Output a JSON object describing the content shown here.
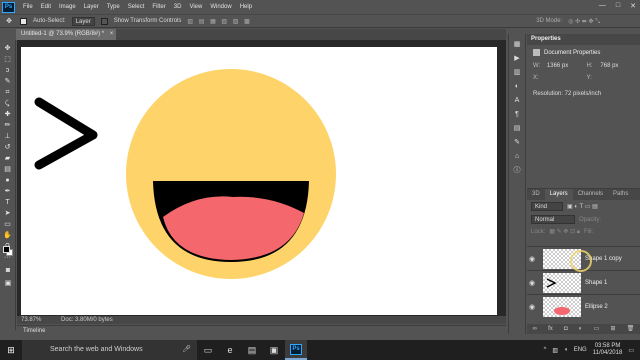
{
  "app": {
    "logo": "Ps"
  },
  "menu": [
    "File",
    "Edit",
    "Image",
    "Layer",
    "Type",
    "Select",
    "Filter",
    "3D",
    "View",
    "Window",
    "Help"
  ],
  "window_controls": [
    "—",
    "□",
    "✕"
  ],
  "options": {
    "auto_select_label": "Auto-Select:",
    "auto_select_value": "Layer",
    "transform_label": "Show Transform Controls",
    "mode_3d": "3D Mode:"
  },
  "document": {
    "tab_title": "Untitled-1 @ 73.9% (RGB/8#) *",
    "zoom": "73.87%",
    "doc_info": "Doc: 3.80M/0 bytes"
  },
  "timeline_label": "Timeline",
  "properties": {
    "tab": "Properties",
    "title": "Document Properties",
    "w_label": "W:",
    "w_value": "1366 px",
    "h_label": "H:",
    "h_value": "768 px",
    "x_label": "X:",
    "y_label": "Y:",
    "resolution": "Resolution: 72 pixels/inch"
  },
  "layers_panel": {
    "tabs": [
      "3D",
      "Layers",
      "Channels",
      "Paths"
    ],
    "active_tab": "Layers",
    "filter": "Kind",
    "blend": "Normal",
    "opacity_label": "Opacity:",
    "lock_label": "Lock:",
    "fill_label": "Fill:",
    "layers": [
      {
        "name": "Shape 1 copy"
      },
      {
        "name": "Shape 1"
      },
      {
        "name": "Ellipse 2"
      }
    ]
  },
  "icons": {
    "tools": [
      "move-icon",
      "marquee-icon",
      "lasso-icon",
      "quick-select-icon",
      "crop-icon",
      "eyedropper-icon",
      "heal-icon",
      "brush-icon",
      "stamp-icon",
      "history-brush-icon",
      "eraser-icon",
      "gradient-icon",
      "dodge-icon",
      "pen-icon",
      "type-icon",
      "path-select-icon",
      "shape-icon",
      "hand-icon",
      "zoom-icon"
    ]
  },
  "colors": {
    "emoji_face": "#fdd36a",
    "emoji_mouth": "#000000",
    "emoji_tongue": "#f4676c",
    "eye_stroke": "#000000"
  },
  "taskbar": {
    "search_placeholder": "Search the web and Windows",
    "lang": "ENG",
    "time": "03:58 PM",
    "date": "11/04/2018"
  }
}
